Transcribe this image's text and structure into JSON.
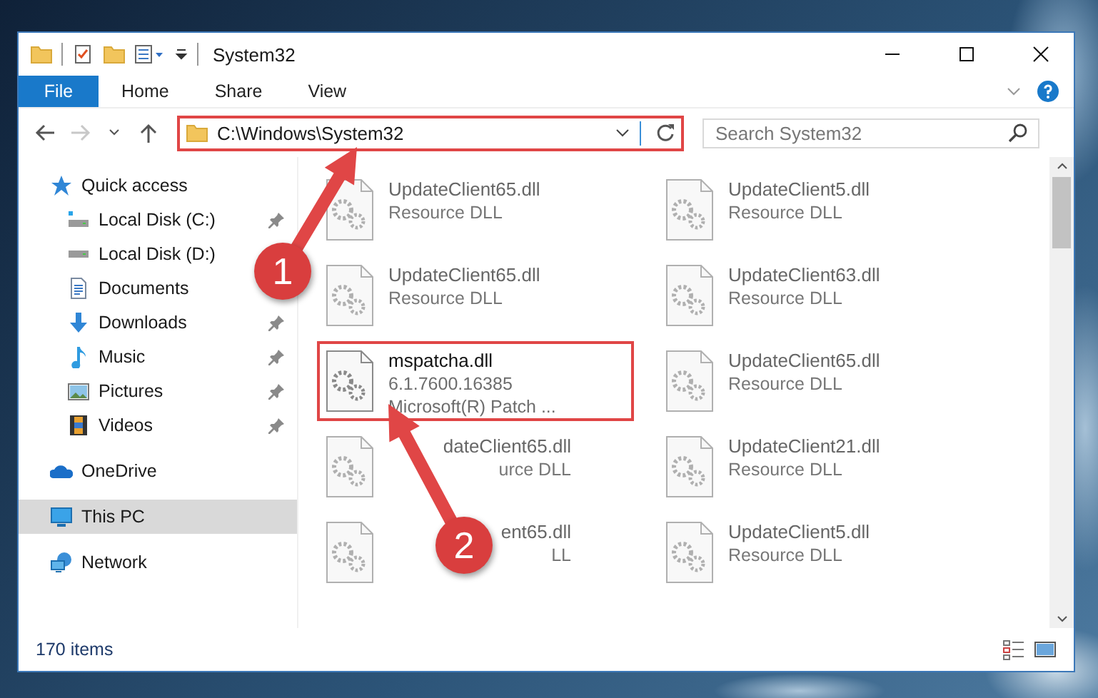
{
  "window": {
    "title": "System32"
  },
  "ribbon": {
    "file_tab": "File",
    "tabs": [
      "Home",
      "Share",
      "View"
    ]
  },
  "address_bar": {
    "path": "C:\\Windows\\System32",
    "highlighted": true
  },
  "search": {
    "placeholder": "Search System32"
  },
  "navigation": [
    {
      "label": "Quick access",
      "kind": "star",
      "selected": false,
      "children": [
        {
          "label": "Local Disk (C:)",
          "kind": "system-drive",
          "pinned": true,
          "selected": false
        },
        {
          "label": "Local Disk (D:)",
          "kind": "drive",
          "pinned": false,
          "selected": false
        },
        {
          "label": "Documents",
          "kind": "documents",
          "pinned": false,
          "selected": false
        },
        {
          "label": "Downloads",
          "kind": "downloads",
          "pinned": true,
          "selected": false
        },
        {
          "label": "Music",
          "kind": "music",
          "pinned": true,
          "selected": false
        },
        {
          "label": "Pictures",
          "kind": "pictures",
          "pinned": true,
          "selected": false
        },
        {
          "label": "Videos",
          "kind": "videos",
          "pinned": true,
          "selected": false
        }
      ]
    },
    {
      "label": "OneDrive",
      "kind": "cloud",
      "selected": false
    },
    {
      "label": "This PC",
      "kind": "pc",
      "selected": true
    },
    {
      "label": "Network",
      "kind": "network",
      "selected": false
    }
  ],
  "files": [
    {
      "kind": "file",
      "name": "UpdateClient65.dll",
      "details": [
        "Resource DLL"
      ],
      "highlighted": false
    },
    {
      "kind": "file",
      "name": "UpdateClient5.dll",
      "details": [
        "Resource DLL"
      ],
      "highlighted": false
    },
    {
      "kind": "file",
      "name": "UpdateClient65.dll",
      "details": [
        "Resource DLL"
      ],
      "highlighted": false
    },
    {
      "kind": "file",
      "name": "UpdateClient63.dll",
      "details": [
        "Resource DLL"
      ],
      "highlighted": false
    },
    {
      "kind": "file",
      "name": "mspatcha.dll",
      "details": [
        "6.1.7600.16385",
        "Microsoft(R) Patch ..."
      ],
      "highlighted": true
    },
    {
      "kind": "file",
      "name": "UpdateClient65.dll",
      "details": [
        "Resource DLL"
      ],
      "highlighted": false
    },
    {
      "kind": "covered",
      "name": "dateClient65.dll",
      "details": [
        "urce DLL"
      ],
      "highlighted": false
    },
    {
      "kind": "file",
      "name": "UpdateClient21.dll",
      "details": [
        "Resource DLL"
      ],
      "highlighted": false
    },
    {
      "kind": "covered",
      "name": "ent65.dll",
      "details": [
        "LL"
      ],
      "highlighted": false
    },
    {
      "kind": "file",
      "name": "UpdateClient5.dll",
      "details": [
        "Resource DLL"
      ],
      "highlighted": false
    }
  ],
  "status_bar": {
    "item_count": "170 items"
  },
  "callouts": [
    {
      "number": "1"
    },
    {
      "number": "2"
    }
  ]
}
